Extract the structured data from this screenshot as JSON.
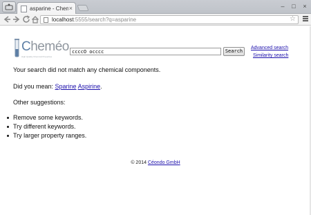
{
  "browser": {
    "tab_title": "asparine - Cheméo Se",
    "tab_close": "×",
    "window_controls": [
      "–",
      "□",
      "×"
    ],
    "url_host": "localhost",
    "url_rest": ":5555/search?q=asparine",
    "icons": [
      "browser-menu-icon",
      "back-icon",
      "forward-icon",
      "reload-icon",
      "home-icon",
      "star-icon",
      "menu-icon"
    ]
  },
  "header": {
    "logo_first_letter": "C",
    "logo_rest": "heméo",
    "logo_tagline": "High Quality Chemical Properties",
    "search_value": "ccccO occcc",
    "search_button": "Search",
    "advanced_search": "Advanced search",
    "similarity_search": "Similarity search"
  },
  "results": {
    "no_match": "Your search did not match any chemical components.",
    "did_you_mean_prefix": "Did you mean: ",
    "suggestion_1": "Sparine",
    "suggestion_2": "Aspirine",
    "suggestion_suffix": ".",
    "other_suggestions": "Other suggestions:",
    "tips": [
      "Remove some keywords.",
      "Try different keywords.",
      "Try larger property ranges."
    ]
  },
  "footer": {
    "copyright": "© 2014 ",
    "company": "Céondo GmbH"
  },
  "colors": {
    "link": "#1a0dab",
    "logo_blue": "#5d7fa6",
    "logo_grey": "#8f969e"
  }
}
